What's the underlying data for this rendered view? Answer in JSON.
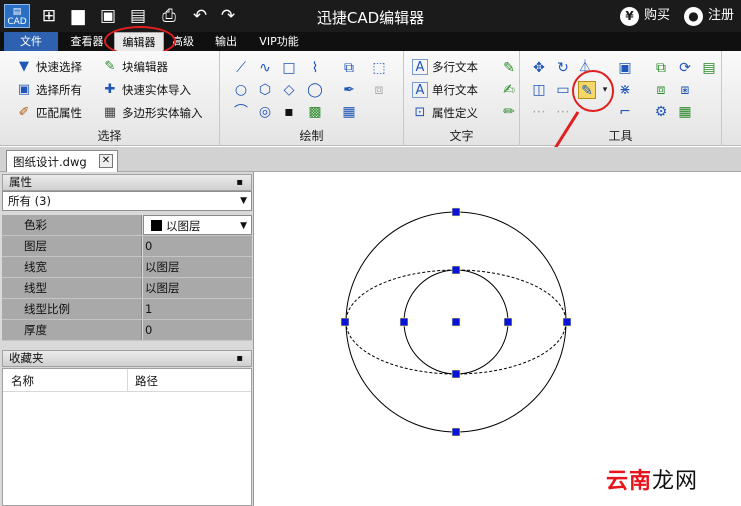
{
  "titlebar": {
    "title": "迅捷CAD编辑器",
    "logo_text": "CAD",
    "buy_label": "购买",
    "buy_icon_glyph": "¥",
    "register_label": "注册",
    "quick_access": [
      {
        "name": "new-icon",
        "glyph": "⊞"
      },
      {
        "name": "open-folder-icon",
        "glyph": "▆"
      },
      {
        "name": "save-icon",
        "glyph": "▣"
      },
      {
        "name": "save-as-icon",
        "glyph": "▤"
      },
      {
        "name": "print-icon",
        "glyph": "⎙"
      },
      {
        "name": "undo-icon",
        "glyph": "↶"
      },
      {
        "name": "redo-icon",
        "glyph": "↷"
      }
    ]
  },
  "menubar": {
    "items": [
      "文件",
      "查看器",
      "编辑器",
      "高级",
      "输出",
      "VIP功能"
    ],
    "active": "编辑器"
  },
  "ribbon": {
    "select_group": {
      "label": "选择",
      "buttons": [
        "快速选择",
        "块编辑器",
        "选择所有",
        "快速实体导入",
        "匹配属性",
        "多边形实体输入"
      ]
    },
    "draw_group": {
      "label": "绘制"
    },
    "text_group": {
      "label": "文字",
      "buttons": [
        "多行文本",
        "单行文本",
        "属性定义"
      ]
    },
    "tools_group": {
      "label": "工具"
    }
  },
  "document_tab": {
    "name": "图纸设计.dwg",
    "close_glyph": "✕"
  },
  "properties": {
    "header": "属性",
    "selection": "所有 (3)",
    "rows": [
      {
        "name": "色彩",
        "value": "以图层"
      },
      {
        "name": "图层",
        "value": "0"
      },
      {
        "name": "线宽",
        "value": "以图层"
      },
      {
        "name": "线型",
        "value": "以图层"
      },
      {
        "name": "线型比例",
        "value": "1"
      },
      {
        "name": "厚度",
        "value": "0"
      }
    ]
  },
  "favorites": {
    "header": "收藏夹",
    "columns": [
      "名称",
      "路径"
    ]
  },
  "watermark": {
    "part1": "云南",
    "part2": "龙网"
  },
  "colors": {
    "grip": "#0a14d8",
    "annotation_red": "#e02020",
    "menu_file_bg": "#2e62b0"
  }
}
